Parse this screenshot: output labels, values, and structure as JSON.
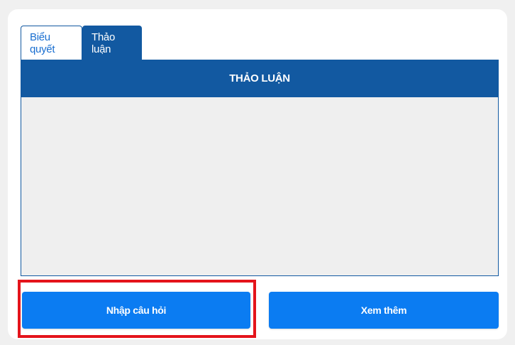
{
  "tabs": [
    {
      "label": "Biểu quyết",
      "active": false
    },
    {
      "label": "Thảo luận",
      "active": true
    }
  ],
  "panel": {
    "header": "THẢO LUẬN"
  },
  "actions": {
    "ask_label": "Nhập câu hỏi",
    "more_label": "Xem thêm"
  },
  "colors": {
    "primary_dark": "#1259a1",
    "button_blue": "#0b7cf2",
    "highlight_red": "#e4141b",
    "panel_body": "#efefef"
  }
}
